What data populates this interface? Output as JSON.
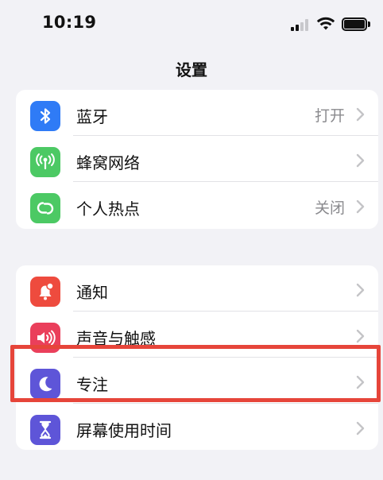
{
  "status_bar": {
    "time": "10:19",
    "signal_icon": "cellular-signal-icon",
    "wifi_icon": "wifi-icon",
    "battery_icon": "battery-icon"
  },
  "nav": {
    "title": "设置"
  },
  "groups": [
    {
      "items": [
        {
          "label": "蓝牙",
          "value": "打开",
          "icon": "bluetooth-icon",
          "icon_color": "#2f7bf6"
        },
        {
          "label": "蜂窝网络",
          "value": "",
          "icon": "cellular-antenna-icon",
          "icon_color": "#4cc964"
        },
        {
          "label": "个人热点",
          "value": "关闭",
          "icon": "personal-hotspot-icon",
          "icon_color": "#4cc964"
        }
      ]
    },
    {
      "items": [
        {
          "label": "通知",
          "value": "",
          "icon": "notification-bell-icon",
          "icon_color": "#ee4b3e"
        },
        {
          "label": "声音与触感",
          "value": "",
          "icon": "speaker-icon",
          "icon_color": "#ea3f5b"
        },
        {
          "label": "专注",
          "value": "",
          "icon": "moon-icon",
          "icon_color": "#5e55d8"
        },
        {
          "label": "屏幕使用时间",
          "value": "",
          "icon": "hourglass-icon",
          "icon_color": "#5e55d8"
        }
      ]
    }
  ],
  "highlight_color": "#e6453a"
}
